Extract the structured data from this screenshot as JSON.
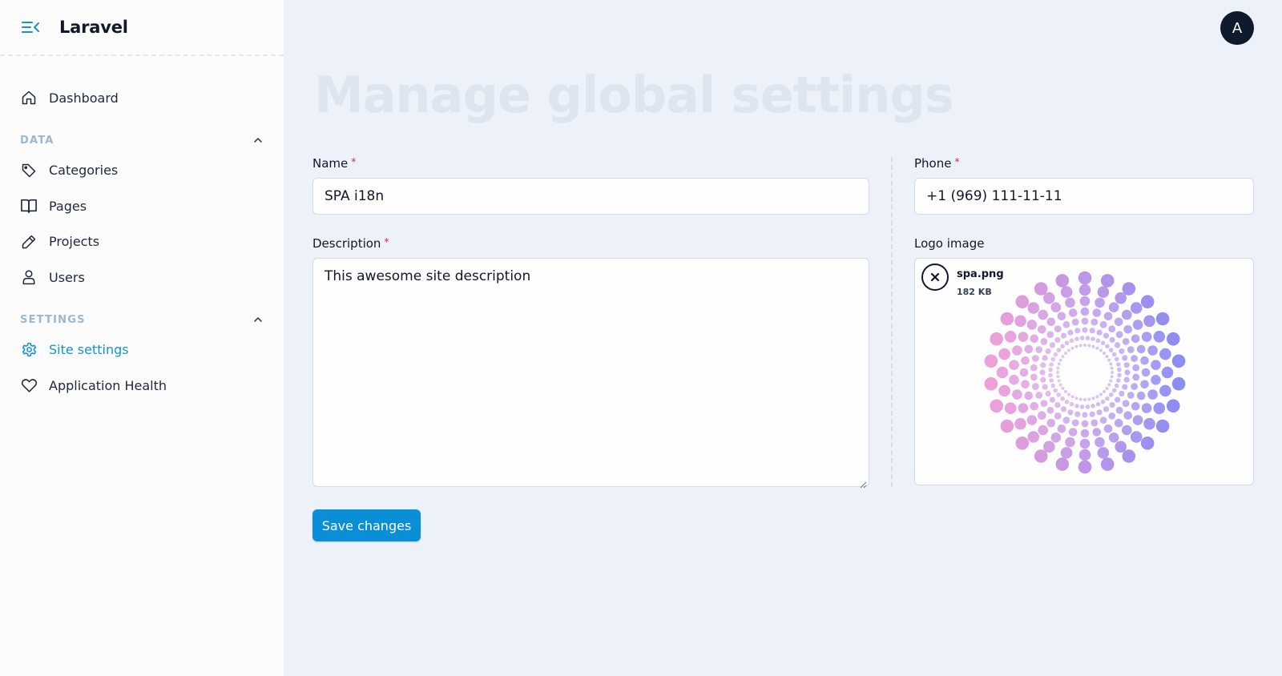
{
  "app": {
    "title": "Laravel"
  },
  "sidebar": {
    "dashboard": "Dashboard",
    "sections": [
      {
        "title": "DATA",
        "items": [
          "Categories",
          "Pages",
          "Projects",
          "Users"
        ]
      },
      {
        "title": "SETTINGS",
        "items": [
          "Site settings",
          "Application Health"
        ]
      }
    ],
    "active_item": "Site settings"
  },
  "header": {
    "avatar_initial": "A"
  },
  "page": {
    "title": "Manage global settings"
  },
  "form": {
    "name": {
      "label": "Name",
      "required_mark": "*",
      "value": "SPA i18n"
    },
    "description": {
      "label": "Description",
      "required_mark": "*",
      "value": "This awesome site description"
    },
    "phone": {
      "label": "Phone",
      "required_mark": "*",
      "value": "+1 (969) 111-11-11"
    },
    "logo": {
      "label": "Logo image",
      "file_name": "spa.png",
      "file_size": "182 KB"
    },
    "save_label": "Save changes"
  },
  "colors": {
    "accent": "#0a8fd6",
    "active_nav": "#1593d2",
    "required": "#e11d48",
    "logo_gradient_start": "#f0a0d8",
    "logo_gradient_end": "#8b8cf5"
  }
}
